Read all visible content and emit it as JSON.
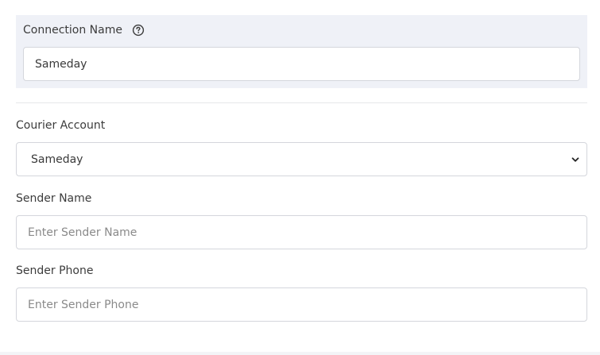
{
  "connection": {
    "label": "Connection Name",
    "value": "Sameday",
    "help_icon": "question-circle-icon"
  },
  "courier_account": {
    "label": "Courier Account",
    "selected": "Sameday",
    "dropdown_icon": "chevron-down-icon"
  },
  "sender_name": {
    "label": "Sender Name",
    "placeholder": "Enter Sender Name"
  },
  "sender_phone": {
    "label": "Sender Phone",
    "placeholder": "Enter Sender Phone"
  },
  "colors": {
    "panel_background": "#eff1f7",
    "input_border": "#d4d6dc",
    "label_text": "#3c3c3c",
    "placeholder_text": "#8a8a8a"
  }
}
